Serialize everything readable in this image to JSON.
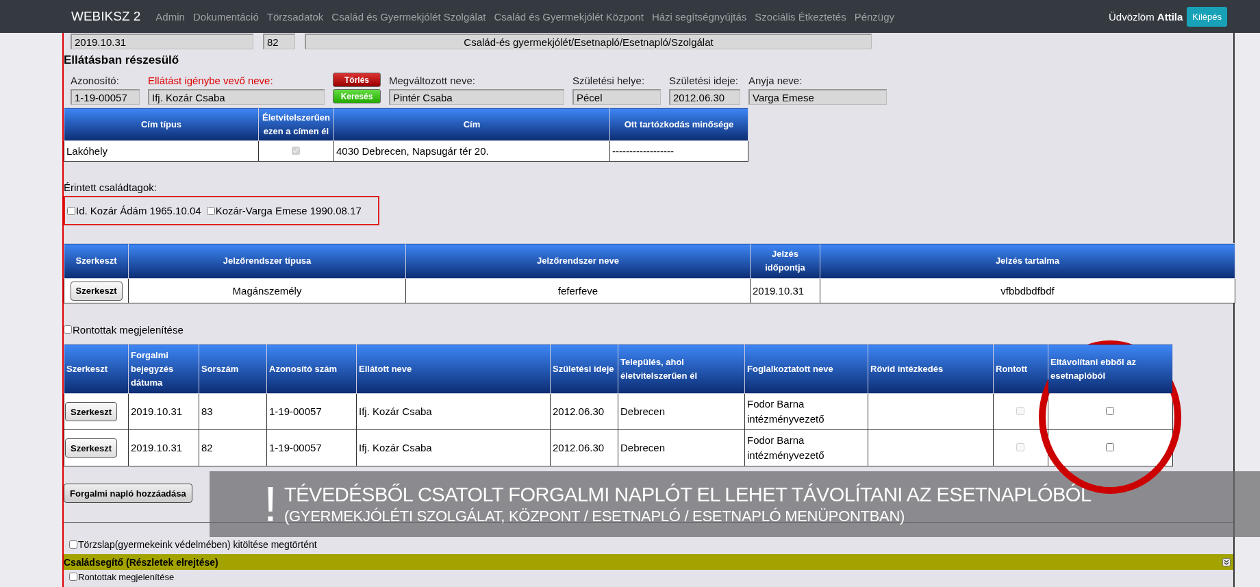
{
  "navbar": {
    "brand": "WEBIKSZ 2",
    "menu": [
      "Admin",
      "Dokumentáció",
      "Törzsadatok",
      "Család és Gyermekjólét Szolgálat",
      "Család és Gyermekjólét Központ",
      "Házi segítségnyújtás",
      "Szociális Étkeztetés",
      "Pénzügy"
    ],
    "greeting": "Üdvözlöm",
    "user": "Attila",
    "logout": "Kilépés"
  },
  "header_fields": [
    "2019.10.31",
    "82",
    "Család-és gyermekjólét/Esetnapló/Esetnapló/Szolgálat"
  ],
  "recipient": {
    "title": "Ellátásban részesülő",
    "fields": [
      {
        "label": "Azonosító:",
        "value": "1-19-00057",
        "required": false
      },
      {
        "label": "Ellátást igénybe vevő neve:",
        "value": "Ifj. Kozár Csaba",
        "required": true
      },
      {
        "label": "Megváltozott neve:",
        "value": "Pintér Csaba",
        "required": false
      },
      {
        "label": "Születési helye:",
        "value": "Pécel",
        "required": false
      },
      {
        "label": "Születési ideje:",
        "value": "2012.06.30",
        "required": false
      },
      {
        "label": "Anyja neve:",
        "value": "Varga Emese",
        "required": false
      }
    ],
    "buttons": [
      {
        "label": "Törlés",
        "kind": "delete"
      },
      {
        "label": "Keresés",
        "kind": "search"
      }
    ]
  },
  "address_table": {
    "columns": [
      "Cím típus",
      "Életvitelszerűen ezen a címen él",
      "Cím",
      "Ott tartózkodás minősége"
    ],
    "rows": [
      {
        "type": "Lakóhely",
        "lives_here": {
          "checked": true,
          "disabled": true
        },
        "address": "4030 Debrecen, Napsugár tér 20.",
        "stay_quality": "------------------"
      }
    ]
  },
  "family": {
    "label": "Érintett családtagok:",
    "members": [
      {
        "name": "Id. Kozár Ádám 1965.10.04",
        "checked": false
      },
      {
        "name": "Kozár-Varga Emese 1990.08.17",
        "checked": false
      }
    ]
  },
  "signal_table": {
    "columns": [
      "Szerkeszt",
      "Jelzőrendszer típusa",
      "Jelzőrendszer neve",
      "Jelzés időpontja",
      "Jelzés tartalma"
    ],
    "rows": [
      {
        "edit": "Szerkeszt",
        "type": "Magánszemély",
        "name": "feferfeve",
        "time": "2019.10.31",
        "content": "vfbbdbdfbdf"
      }
    ]
  },
  "show_spoiled": {
    "label": "Rontottak megjelenítése",
    "checked": false
  },
  "traffic_table": {
    "columns": [
      "Szerkeszt",
      "Forgalmi bejegyzés dátuma",
      "Sorszám",
      "Azonosító szám",
      "Ellátott neve",
      "Születési ideje",
      "Település, ahol életvitelszerűen él",
      "Foglalkoztatott neve",
      "Rövid intézkedés",
      "Rontott",
      "Eltávolítani ebből az esetnaplóból"
    ],
    "rows": [
      {
        "edit": "Szerkeszt",
        "date": "2019.10.31",
        "number": "83",
        "id": "1-19-00057",
        "name": "Ifj. Kozár Csaba",
        "birth": "2012.06.30",
        "settlement": "Debrecen",
        "employee": "Fodor Barna intézményvezető",
        "spoiled": {
          "checked": false,
          "disabled": true
        },
        "remove": {
          "checked": false,
          "disabled": false
        }
      },
      {
        "edit": "Szerkeszt",
        "date": "2019.10.31",
        "number": "82",
        "id": "1-19-00057",
        "name": "Ifj. Kozár Csaba",
        "birth": "2012.06.30",
        "settlement": "Debrecen",
        "employee": "Fodor Barna intézményvezető",
        "spoiled": {
          "checked": false,
          "disabled": true
        },
        "remove": {
          "checked": false,
          "disabled": false
        }
      }
    ]
  },
  "add_button": "Forgalmi napló hozzáadása",
  "registry": {
    "label": "Törzslap(gyermekeink védelmében) kitöltése megtörtént",
    "checked": false
  },
  "family_helper": {
    "title": "Családsegítő (Részletek elrejtése)"
  },
  "spoiled_bottom": {
    "label": "Rontottak megjelenítése",
    "checked": false
  },
  "annotation": {
    "mark": "!",
    "line1": "TÉVEDÉSBŐL CSATOLT FORGALMI NAPLÓT EL LEHET TÁVOLÍTANI AZ ESETNAPLÓBÓL",
    "line2": "(GYERMEKJÓLÉTI SZOLGÁLAT, KÖZPONT / ESETNAPLÓ / ESETNAPLÓ MENÜPONTBAN)"
  }
}
